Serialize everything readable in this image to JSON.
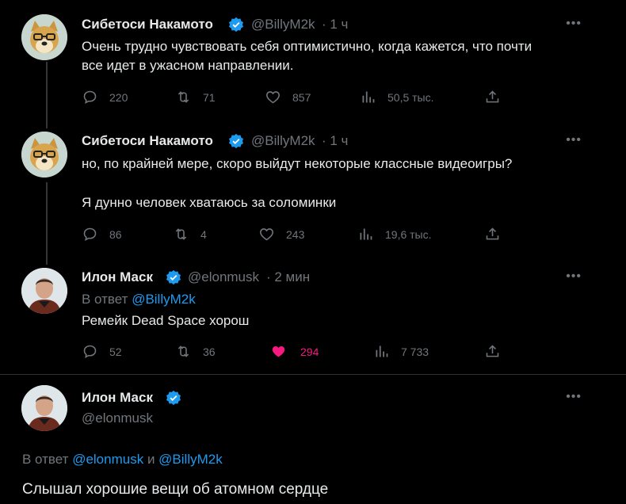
{
  "tweets": [
    {
      "author": "Сибетоси Накамото",
      "handle": "@BillyM2k",
      "time": "· 1 ч",
      "text_lines": [
        "Очень трудно чувствовать себя оптимистично, когда кажется, что почти",
        "все идет в ужасном направлении."
      ],
      "stats": {
        "replies": "220",
        "retweets": "71",
        "likes": "857",
        "views": "50,5 тыс."
      }
    },
    {
      "author": "Сибетоси Накамото",
      "handle": "@BillyM2k",
      "time": "· 1 ч",
      "text_line1": "но, по крайней мере, скоро выйдут некоторые классные видеоигры?",
      "text_line2": "Я дунно человек хватаюсь за соломинки",
      "stats": {
        "replies": "86",
        "retweets": "4",
        "likes": "243",
        "views": "19,6 тыс."
      }
    },
    {
      "author": "Илон Маск",
      "handle": "@elonmusk",
      "time": "· 2 мин",
      "reply_prefix": "В ответ",
      "reply_to": "@BillyM2k",
      "text": "Ремейк Dead Space хорош",
      "stats": {
        "replies": "52",
        "retweets": "36",
        "likes": "294",
        "views": "7 733"
      }
    }
  ],
  "focused_tweet": {
    "author": "Илон Маск",
    "handle": "@elonmusk",
    "reply_prefix": "В ответ",
    "reply_to_1": "@elonmusk",
    "reply_and": "и",
    "reply_to_2": "@BillyM2k",
    "text": "Слышал хорошие вещи об атомном сердце"
  },
  "more_label": "•••",
  "colors": {
    "accent": "#1d9bf0",
    "like": "#f91880",
    "muted": "#71767b",
    "text": "#e7e9ea",
    "background": "#000000"
  },
  "icons": [
    "reply-icon",
    "retweet-icon",
    "like-icon",
    "views-icon",
    "share-icon",
    "verified-badge-icon",
    "more-icon"
  ]
}
